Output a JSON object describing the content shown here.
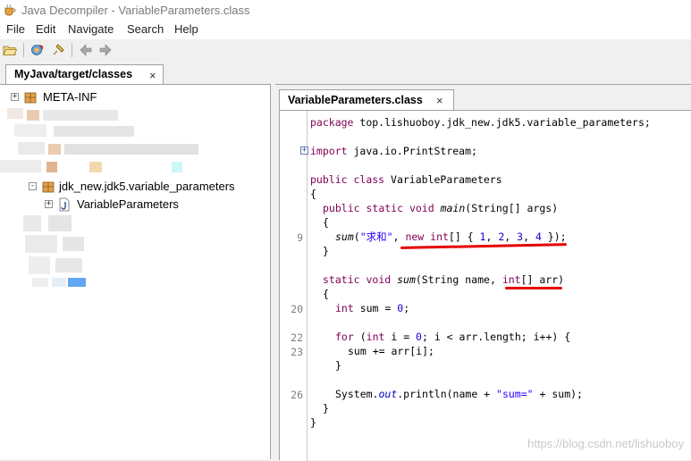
{
  "window": {
    "title": "Java Decompiler - VariableParameters.class"
  },
  "menu": [
    "File",
    "Edit",
    "Navigate",
    "Search",
    "Help"
  ],
  "toolbar": {
    "buttons": [
      "open-file-icon",
      "open-type-icon",
      "pin-icon",
      "back-arrow-icon",
      "forward-arrow-icon"
    ]
  },
  "outer_tab": {
    "label": "MyJava/target/classes",
    "close": "×"
  },
  "tree": {
    "items": [
      {
        "label": "META-INF",
        "expander": "+",
        "icon": "package-icon"
      },
      {
        "label": "jdk_new.jdk5.variable_parameters",
        "expander": "-",
        "icon": "package-icon"
      },
      {
        "label": "VariableParameters",
        "expander": "+",
        "icon": "java-class-file-icon"
      }
    ]
  },
  "editor_tab": {
    "label": "VariableParameters.class",
    "close": "×"
  },
  "code": {
    "package_kw": "package",
    "package_name": " top.lishuoboy.jdk_new.jdk5.variable_parameters;",
    "import_kw": "import",
    "import_name": " java.io.PrintStream;",
    "class_public": "public",
    "class_kw": " class",
    "class_name": " VariableParameters",
    "open_brace": "{",
    "main_public": "public",
    "main_static": " static",
    "main_void": " void",
    "main_name": " main",
    "main_args": "(String[] args)",
    "inner_open": "{",
    "call_sum": "sum",
    "call_p1": "(",
    "call_str": "\"求和\"",
    "call_p2": ", ",
    "call_new": "new",
    "call_int": " int",
    "call_p3": "[] { ",
    "call_n1": "1",
    "call_c1": ", ",
    "call_n2": "2",
    "call_c2": ", ",
    "call_n3": "3",
    "call_c3": ", ",
    "call_n4": "4",
    "call_end": " });",
    "inner_close": "}",
    "sum_static": "static",
    "sum_void": " void",
    "sum_name": " sum",
    "sum_p1": "(String name, ",
    "sum_int": "int",
    "sum_p2": "[] arr)",
    "sum_open": "{",
    "l20_int": "int",
    "l20_rest": " sum = ",
    "l20_zero": "0",
    "l20_end": ";",
    "l22_for": "for",
    "l22_p1": " (",
    "l22_int": "int",
    "l22_p2": " i = ",
    "l22_zero": "0",
    "l22_p3": "; i < arr.length; i++) {",
    "l23": "sum += arr[i];",
    "l23_close": "}",
    "l26_a": "System.",
    "l26_out": "out",
    "l26_b": ".println(name + ",
    "l26_str": "\"sum=\"",
    "l26_c": " + sum);",
    "sum_close": "}",
    "class_close": "}"
  },
  "gutter": {
    "line_9": "9",
    "line_20": "20",
    "line_22": "22",
    "line_23": "23",
    "line_26": "26",
    "fold": "+"
  },
  "annotations": {
    "underline_color": "#e60000"
  },
  "watermark": "https://blog.csdn.net/lishuoboy"
}
